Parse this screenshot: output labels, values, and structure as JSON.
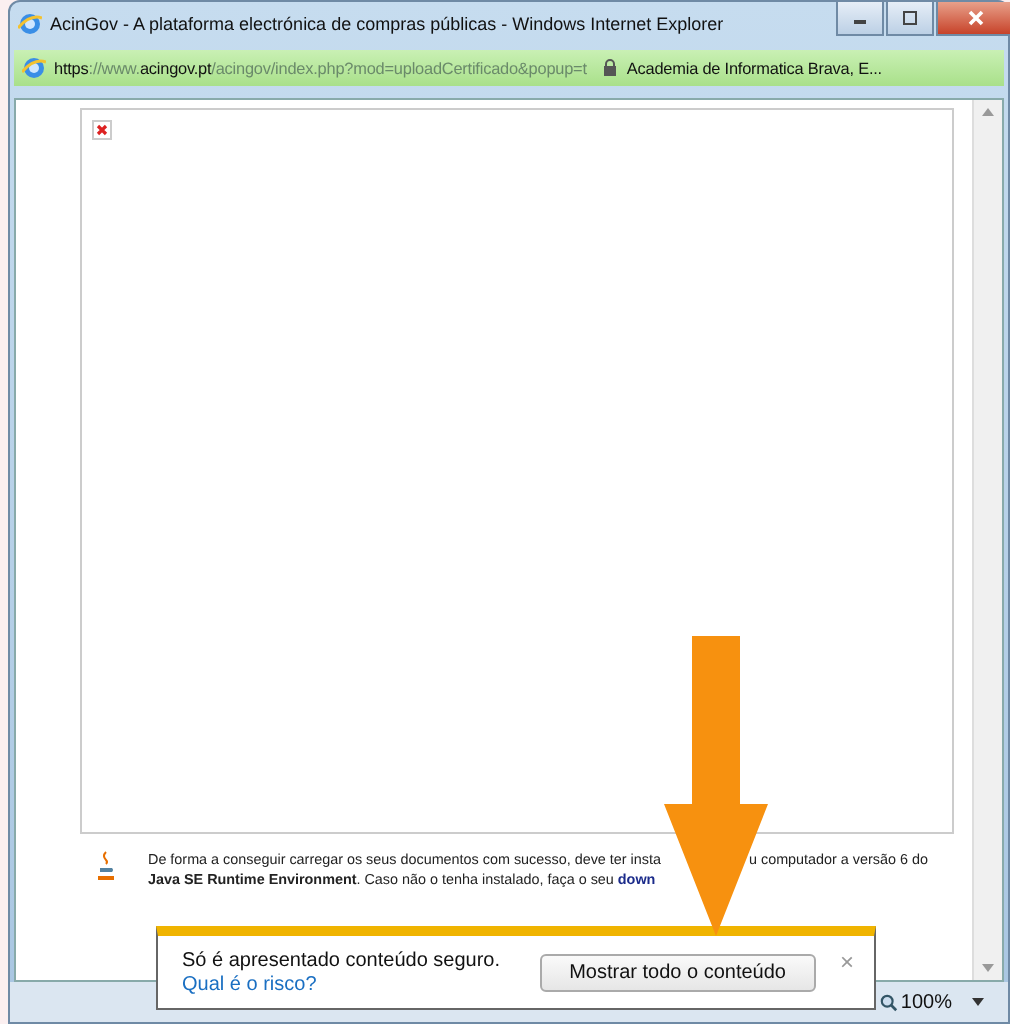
{
  "window": {
    "title": "AcinGov - A plataforma electrónica de compras públicas - Windows Internet Explorer"
  },
  "address_bar": {
    "scheme": "https",
    "host": "://www.acingov.pt",
    "path": "/acingov/index.php?mod=uploadCertificado&popup=t",
    "site_identity": "Academia de Informatica Brava, E..."
  },
  "page": {
    "java_notice": {
      "line_1_start": "De forma a conseguir carregar os seus documentos com sucesso, deve ter insta",
      "line_1_end": "u computador a versão 6 do",
      "line_2": "**Java SE Runtime Environment**. Caso não o tenha instalado, faça o seu",
      "line_2_link": "down"
    }
  },
  "info_bar": {
    "message": "Só é apresentado conteúdo seguro.",
    "link": "Qual é o risco?",
    "button": "Mostrar todo o conteúdo",
    "close": "×"
  },
  "status_bar": {
    "zoom": "100%"
  }
}
